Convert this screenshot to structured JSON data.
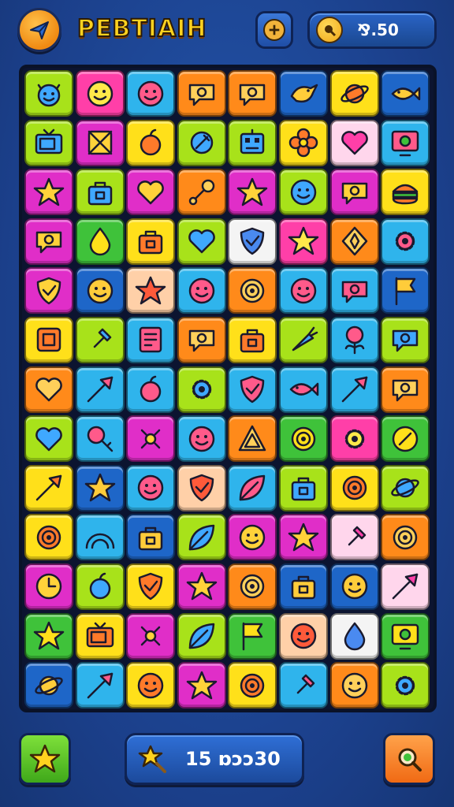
{
  "header": {
    "title": "PEBTIAIH",
    "coins_label": "⅋.50"
  },
  "footer": {
    "score_label": "15 ɒɔɔ30"
  },
  "colors": {
    "red": "#ff4a3a",
    "orange": "#ff8a1a",
    "yellow": "#ffe01a",
    "lime": "#a8e21a",
    "green": "#3fc23a",
    "cyan": "#2fb4ec",
    "blue": "#1e66c8",
    "pink": "#ff3fa8",
    "magenta": "#e02ec8",
    "peach": "#ffd0a8",
    "lightpink": "#ffd6ec",
    "white": "#f4f4f4"
  },
  "board": {
    "rows": [
      [
        [
          "lime",
          "devil-face"
        ],
        [
          "pink",
          "smiley-face"
        ],
        [
          "cyan",
          "smiley-face"
        ],
        [
          "orange",
          "chat-bubble"
        ],
        [
          "orange",
          "chat-bubble"
        ],
        [
          "blue",
          "bird"
        ],
        [
          "yellow",
          "planet"
        ],
        [
          "blue",
          "fish"
        ]
      ],
      [
        [
          "lime",
          "tv"
        ],
        [
          "magenta",
          "crate"
        ],
        [
          "yellow",
          "apple"
        ],
        [
          "lime",
          "satellite"
        ],
        [
          "lime",
          "robot"
        ],
        [
          "yellow",
          "flower"
        ],
        [
          "lightpink",
          "heart"
        ],
        [
          "cyan",
          "monitor"
        ]
      ],
      [
        [
          "magenta",
          "star"
        ],
        [
          "lime",
          "bag"
        ],
        [
          "magenta",
          "heart"
        ],
        [
          "orange",
          "wrench"
        ],
        [
          "magenta",
          "star"
        ],
        [
          "lime",
          "smiley-face"
        ],
        [
          "magenta",
          "chat-bubble"
        ],
        [
          "yellow",
          "burger"
        ]
      ],
      [
        [
          "magenta",
          "chat-bubble"
        ],
        [
          "green",
          "drop"
        ],
        [
          "yellow",
          "bag"
        ],
        [
          "lime",
          "heart"
        ],
        [
          "white",
          "shield"
        ],
        [
          "pink",
          "star"
        ],
        [
          "orange",
          "diamond"
        ],
        [
          "cyan",
          "gear"
        ]
      ],
      [
        [
          "magenta",
          "shield"
        ],
        [
          "blue",
          "smiley-face"
        ],
        [
          "peach",
          "star"
        ],
        [
          "cyan",
          "smiley-face"
        ],
        [
          "orange",
          "target"
        ],
        [
          "cyan",
          "smiley-face"
        ],
        [
          "cyan",
          "chat-bubble"
        ],
        [
          "blue",
          "flag"
        ]
      ],
      [
        [
          "yellow",
          "square"
        ],
        [
          "lime",
          "hammer"
        ],
        [
          "cyan",
          "note"
        ],
        [
          "orange",
          "chat-bubble"
        ],
        [
          "yellow",
          "bag"
        ],
        [
          "lime",
          "carrot"
        ],
        [
          "cyan",
          "rose"
        ],
        [
          "lime",
          "chat-bubble"
        ]
      ],
      [
        [
          "orange",
          "heart"
        ],
        [
          "cyan",
          "arrow"
        ],
        [
          "cyan",
          "apple"
        ],
        [
          "lime",
          "gear"
        ],
        [
          "cyan",
          "shield"
        ],
        [
          "cyan",
          "fish"
        ],
        [
          "cyan",
          "arrow"
        ],
        [
          "orange",
          "chat-bubble"
        ]
      ],
      [
        [
          "lime",
          "heart"
        ],
        [
          "cyan",
          "key"
        ],
        [
          "magenta",
          "cross"
        ],
        [
          "cyan",
          "smiley-face"
        ],
        [
          "orange",
          "triangle"
        ],
        [
          "green",
          "target"
        ],
        [
          "pink",
          "gear"
        ],
        [
          "green",
          "circle"
        ]
      ],
      [
        [
          "yellow",
          "arrow"
        ],
        [
          "blue",
          "star"
        ],
        [
          "cyan",
          "smiley-face"
        ],
        [
          "peach",
          "shield"
        ],
        [
          "cyan",
          "leaf"
        ],
        [
          "lime",
          "bag"
        ],
        [
          "yellow",
          "target"
        ],
        [
          "lime",
          "planet"
        ]
      ],
      [
        [
          "yellow",
          "target"
        ],
        [
          "cyan",
          "rainbow"
        ],
        [
          "blue",
          "bag"
        ],
        [
          "lime",
          "leaf"
        ],
        [
          "magenta",
          "smiley-face"
        ],
        [
          "magenta",
          "star"
        ],
        [
          "lightpink",
          "hammer"
        ],
        [
          "orange",
          "target"
        ]
      ],
      [
        [
          "magenta",
          "clock"
        ],
        [
          "lime",
          "apple"
        ],
        [
          "yellow",
          "shield"
        ],
        [
          "magenta",
          "star"
        ],
        [
          "orange",
          "target"
        ],
        [
          "blue",
          "bag"
        ],
        [
          "blue",
          "smiley-face"
        ],
        [
          "lightpink",
          "arrow"
        ]
      ],
      [
        [
          "green",
          "star"
        ],
        [
          "yellow",
          "tv"
        ],
        [
          "magenta",
          "cross"
        ],
        [
          "lime",
          "leaf"
        ],
        [
          "green",
          "flag"
        ],
        [
          "peach",
          "smiley-face"
        ],
        [
          "white",
          "drop"
        ],
        [
          "green",
          "monitor"
        ]
      ],
      [
        [
          "blue",
          "planet"
        ],
        [
          "cyan",
          "arrow"
        ],
        [
          "yellow",
          "smiley-face"
        ],
        [
          "magenta",
          "star"
        ],
        [
          "yellow",
          "target"
        ],
        [
          "cyan",
          "hammer"
        ],
        [
          "orange",
          "smiley-face"
        ],
        [
          "lime",
          "gear"
        ]
      ]
    ]
  }
}
